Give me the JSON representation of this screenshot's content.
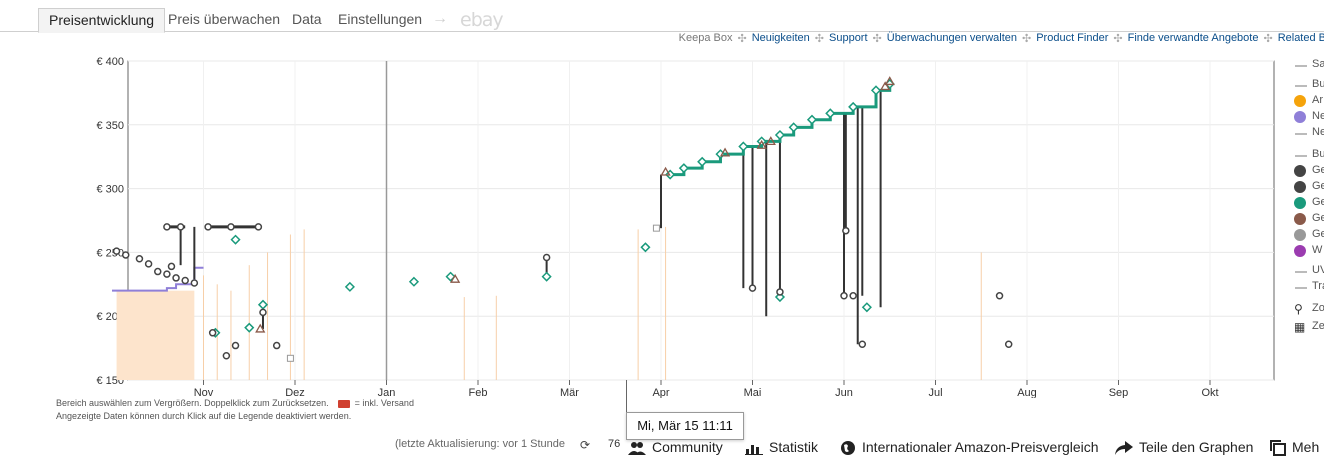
{
  "tabs": [
    {
      "label": "Preisentwicklung",
      "active": true
    },
    {
      "label": "Preis überwachen",
      "active": false
    },
    {
      "label": "Data",
      "active": false
    },
    {
      "label": "Einstellungen",
      "active": false
    }
  ],
  "tabs_extra": {
    "arrow": "→",
    "ebay": "ebay"
  },
  "topbar": {
    "brand": "Keepa Box",
    "links": [
      "Neuigkeiten",
      "Support",
      "Überwachungen verwalten",
      "Product Finder",
      "Finde verwandte Angebote",
      "Related B"
    ]
  },
  "colors": {
    "accent_link": "#0b4e8a",
    "green_series": "#1a9a7c",
    "dark_series": "#444444",
    "purple_series": "#8f7fd8",
    "orange_area": "#fde4cc",
    "brown_series": "#8a5a4a",
    "gray_series": "#999999"
  },
  "chart_data": {
    "type": "scatter",
    "ylim": [
      150,
      400
    ],
    "yticks": [
      "€ 150",
      "€ 200",
      "€ 250",
      "€ 300",
      "€ 350",
      "€ 400"
    ],
    "xticks": [
      "Nov",
      "Dez",
      "Jan",
      "Feb",
      "Mär",
      "Apr",
      "Mai",
      "Jun",
      "Jul",
      "Aug",
      "Sep",
      "Okt"
    ],
    "grid": true,
    "legend": "right",
    "series": [
      {
        "name": "Ge",
        "color": "#1a9a7c",
        "marker": "diamond",
        "points": [
          [
            1.35,
            260
          ],
          [
            1.13,
            187
          ],
          [
            1.5,
            191
          ],
          [
            1.65,
            209
          ],
          [
            2.6,
            223
          ],
          [
            3.3,
            227
          ],
          [
            3.7,
            231
          ],
          [
            4.75,
            231
          ],
          [
            5.83,
            254
          ],
          [
            6.1,
            311
          ],
          [
            6.25,
            316
          ],
          [
            6.45,
            321
          ],
          [
            6.65,
            327
          ],
          [
            6.9,
            333
          ],
          [
            7.1,
            337
          ],
          [
            7.3,
            342
          ],
          [
            7.45,
            348
          ],
          [
            7.65,
            354
          ],
          [
            7.85,
            359
          ],
          [
            8.1,
            364
          ],
          [
            8.35,
            377
          ],
          [
            8.5,
            382
          ],
          [
            7.3,
            215
          ],
          [
            8.25,
            207
          ]
        ]
      },
      {
        "name": "Ge",
        "color": "#444444",
        "marker": "circle",
        "points": [
          [
            0.05,
            251
          ],
          [
            0.15,
            248
          ],
          [
            0.3,
            245
          ],
          [
            0.4,
            241
          ],
          [
            0.5,
            235
          ],
          [
            0.6,
            233
          ],
          [
            0.7,
            230
          ],
          [
            0.8,
            228
          ],
          [
            0.9,
            226
          ],
          [
            0.6,
            270
          ],
          [
            0.75,
            270
          ],
          [
            1.05,
            270
          ],
          [
            1.3,
            270
          ],
          [
            1.6,
            270
          ],
          [
            0.65,
            239
          ],
          [
            1.1,
            187
          ],
          [
            1.25,
            169
          ],
          [
            1.35,
            177
          ],
          [
            1.65,
            203
          ],
          [
            1.8,
            177
          ],
          [
            4.75,
            246
          ],
          [
            7.0,
            222
          ],
          [
            7.3,
            219
          ],
          [
            8.0,
            216
          ],
          [
            8.02,
            267
          ],
          [
            8.1,
            216
          ],
          [
            8.2,
            178
          ],
          [
            9.7,
            216
          ],
          [
            9.8,
            178
          ]
        ]
      },
      {
        "name": "Ge",
        "color": "#8a5a4a",
        "marker": "triangle",
        "points": [
          [
            3.75,
            229
          ],
          [
            1.62,
            190
          ],
          [
            6.05,
            313
          ],
          [
            6.7,
            328
          ],
          [
            7.1,
            334
          ],
          [
            7.2,
            337
          ],
          [
            8.45,
            380
          ],
          [
            8.5,
            384
          ]
        ]
      },
      {
        "name": "Ge",
        "color": "#999999",
        "marker": "square",
        "points": [
          [
            1.95,
            167
          ],
          [
            5.95,
            269
          ]
        ]
      },
      {
        "name": "Ne",
        "color": "#8f7fd8",
        "marker": "line",
        "points": [
          [
            0.0,
            220
          ],
          [
            0.5,
            220
          ],
          [
            0.6,
            222
          ],
          [
            0.7,
            225
          ],
          [
            0.78,
            225
          ],
          [
            0.9,
            238
          ],
          [
            1.0,
            238
          ]
        ]
      }
    ]
  },
  "legend": {
    "items": [
      {
        "label": "Sa",
        "kind": "line",
        "color": "#bbbbbb"
      },
      {
        "label": "Bu",
        "kind": "line",
        "color": "#bbbbbb"
      },
      {
        "label": "Ar",
        "kind": "dot",
        "color": "#f5a30b"
      },
      {
        "label": "Ne",
        "kind": "dot",
        "color": "#8f7fd8"
      },
      {
        "label": "Ne",
        "kind": "line",
        "color": "#bbbbbb"
      },
      {
        "label": "Bu",
        "kind": "line",
        "color": "#bbbbbb"
      },
      {
        "label": "Ge",
        "kind": "dot",
        "color": "#444444"
      },
      {
        "label": "Ge",
        "kind": "dot",
        "color": "#444444"
      },
      {
        "label": "Ge",
        "kind": "dot",
        "color": "#1a9a7c"
      },
      {
        "label": "Ge",
        "kind": "dot",
        "color": "#8a5a4a"
      },
      {
        "label": "Ge",
        "kind": "dot",
        "color": "#999999"
      },
      {
        "label": "W",
        "kind": "dot",
        "color": "#9b3cb0"
      },
      {
        "label": "UV",
        "kind": "line",
        "color": "#bbbbbb"
      },
      {
        "label": "Tra",
        "kind": "line",
        "color": "#bbbbbb"
      },
      {
        "label": "Zo",
        "kind": "icon",
        "icon": "search-icon"
      },
      {
        "label": "Ze",
        "kind": "icon",
        "icon": "calendar-icon"
      }
    ]
  },
  "notes": {
    "line1_a": "Bereich auswählen zum Vergrößern. Doppelklick zum Zurücksetzen.",
    "line1_b": "= inkl. Versand",
    "line2": "Angezeigte Daten können durch Klick auf die Legende deaktiviert werden."
  },
  "tooltip": {
    "text": "Mi, Mär 15 11:11"
  },
  "bottom": {
    "update_text": "(letzte Aktualisierung: vor 1 Stunde",
    "community_count": "76",
    "community": "Community",
    "statistik": "Statistik",
    "international": "Internationaler Amazon-Preisvergleich",
    "share": "Teile den Graphen",
    "more": "Meh"
  }
}
